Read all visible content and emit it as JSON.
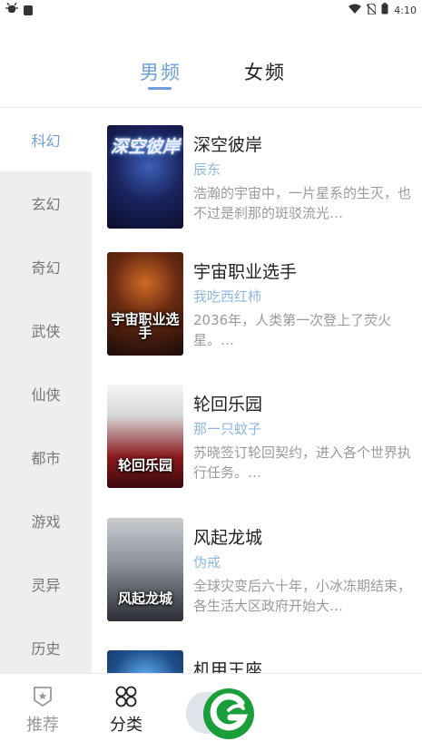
{
  "status_bar": {
    "time": "4:10"
  },
  "gender_tabs": [
    {
      "label": "男频",
      "active": true
    },
    {
      "label": "女频",
      "active": false
    }
  ],
  "categories": [
    {
      "label": "科幻",
      "active": true
    },
    {
      "label": "玄幻",
      "active": false
    },
    {
      "label": "奇幻",
      "active": false
    },
    {
      "label": "武侠",
      "active": false
    },
    {
      "label": "仙侠",
      "active": false
    },
    {
      "label": "都市",
      "active": false
    },
    {
      "label": "游戏",
      "active": false
    },
    {
      "label": "灵异",
      "active": false
    },
    {
      "label": "历史",
      "active": false
    }
  ],
  "books": [
    {
      "title": "深空彼岸",
      "author": "辰东",
      "description": "浩瀚的宇宙中，一片星系的生灭，也不过是刹那的斑驳流光…",
      "cover_text": "深空彼岸"
    },
    {
      "title": "宇宙职业选手",
      "author": "我吃西红柿",
      "description": "2036年，人类第一次登上了荧火星。…",
      "cover_text": "宇宙职业选手"
    },
    {
      "title": "轮回乐园",
      "author": "那一只蚊子",
      "description": "苏晓签订轮回契约，进入各个世界执行任务。…",
      "cover_text": "轮回乐园"
    },
    {
      "title": "风起龙城",
      "author": "伪戒",
      "description": "全球灾变后六十年，小冰冻期结束，各生活大区政府开始大…",
      "cover_text": "风起龙城"
    },
    {
      "title": "机甲王座",
      "author": "",
      "description": "",
      "cover_text": ""
    }
  ],
  "bottom_nav": [
    {
      "label": "推荐",
      "icon": "badge-star-icon",
      "active": false
    },
    {
      "label": "分类",
      "icon": "category-grid-icon",
      "active": true
    }
  ],
  "colors": {
    "accent": "#6ea0d6",
    "author": "#8fb7df",
    "sidebar_bg": "#eeeeee",
    "logo_green": "#1a9e3a"
  }
}
